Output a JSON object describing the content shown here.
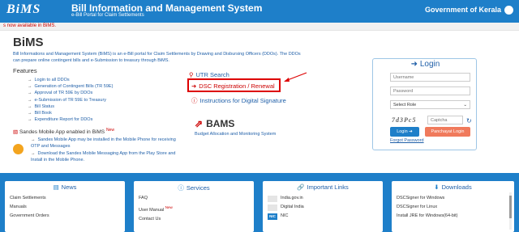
{
  "header": {
    "logo": "BiMS",
    "title": "Bill Information and Management System",
    "subtitle": "e-Bill Portal for Claim Settlements",
    "government": "Government of Kerala"
  },
  "ticker": "s now available in BiMS.",
  "main": {
    "title": "BiMS",
    "intro": "Bill Informations and Management System (BiMS) is an e-Bill portal for Claim Settlements by Drawing and Disbursing Officers (DDOs). The DDOs can prepare online contingent bills and e-Submission to treasury through BiMS.",
    "features_heading": "Features",
    "features": [
      "Login to all DDOs",
      "Generation of Contingent Bills (TR 59E)",
      "Approval of TR 59E by DDOs",
      "e-Submission of TR 59E to Treasury",
      "Bill Status",
      "Bill Book",
      "Expenditure Report for DDOs"
    ],
    "sandes_heading": "Sandes Mobile App enabled in BiMS",
    "sandes_badge": "New",
    "sandes_items": [
      "Sandes Mobile App may be installed in the Mobile Phone for receiving OTP and Messages",
      "Download the Sandes Mobile Messaging App from the Play Store and Install in the Mobile Phone."
    ]
  },
  "middle": {
    "utr_search": "UTR Search",
    "dsc_registration": "DSC Registration / Renewal",
    "dsc_instructions": "Instructions for Digital Signature",
    "bams_title": "BAMS",
    "bams_subtitle": "Budget Allocation and Monitoring System"
  },
  "login": {
    "heading": "Login",
    "username_placeholder": "Username",
    "password_placeholder": "Password",
    "role_selected": "Select Role",
    "captcha_text": "7d3Pc5",
    "captcha_placeholder": "Captcha",
    "login_button": "Login",
    "panchayat_button": "Panchayat Login",
    "forgot_password": "Forgot Password"
  },
  "panels": {
    "news": {
      "title": "News",
      "items": [
        "Claim Settlements",
        "Manuals",
        "Government Orders"
      ]
    },
    "services": {
      "title": "Services",
      "items": [
        "FAQ",
        "User Manual",
        "Contact Us"
      ],
      "new_badge": "New"
    },
    "important_links": {
      "title": "Important Links",
      "items": [
        "India.gov.in",
        "Digital India",
        "NIC"
      ],
      "nic_logo": "NIC"
    },
    "downloads": {
      "title": "Downloads",
      "items": [
        "DSCSigner for Windows",
        "DSCSigner for Linux",
        "Install JRE for Windows(64-bit)"
      ]
    }
  },
  "colors": {
    "brand": "#1e7fc9",
    "link": "#1f5fa8",
    "alert": "#cc0000",
    "panchayat_button": "#f07a5c"
  },
  "icons": [
    "search-icon",
    "sign-in-icon",
    "info-icon",
    "external-link-icon",
    "refresh-icon",
    "mobile-icon",
    "newspaper-icon",
    "info-circle-icon",
    "link-icon",
    "download-icon"
  ]
}
